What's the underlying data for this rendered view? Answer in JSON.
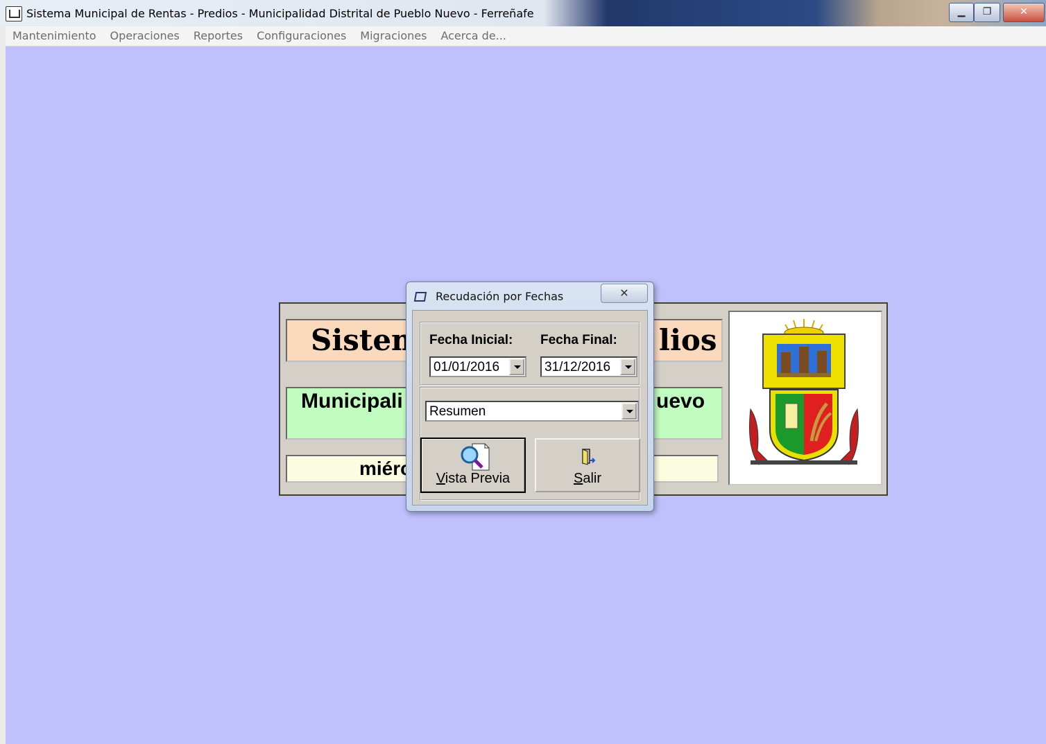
{
  "window": {
    "title": "Sistema Municipal de Rentas - Predios - Municipalidad Distrital de Pueblo Nuevo - Ferreñafe",
    "buttons": [
      "minimize",
      "restore",
      "close"
    ]
  },
  "menu": [
    "Mantenimiento",
    "Operaciones",
    "Reportes",
    "Configuraciones",
    "Migraciones",
    "Acerca de..."
  ],
  "background_panel": {
    "title_left": "Sistem",
    "title_right": "lios",
    "muni_left": "Municipali",
    "muni_right": "uevo",
    "date_left": "miérc"
  },
  "dialog": {
    "title": "Recudación por Fechas",
    "close_symbol": "✕",
    "fecha_inicial_label": "Fecha Inicial:",
    "fecha_final_label": "Fecha Final:",
    "fecha_inicial_value": "01/01/2016",
    "fecha_final_value": "31/12/2016",
    "report_type_value": "Resumen",
    "vista_previa_accesskey": "V",
    "vista_previa_rest": "ista Previa",
    "salir_accesskey": "S",
    "salir_rest": "alir"
  },
  "colors": {
    "desktop": "#c0c0fc",
    "title_bg": "#fbd9bd",
    "muni_bg": "#c0fcc0",
    "date_bg": "#fcfce0",
    "dialog_face": "#d4d0c8"
  },
  "icons": [
    "app-icon",
    "dialog-icon",
    "magnifier-document-icon",
    "exit-door-icon",
    "municipal-crest-image"
  ]
}
